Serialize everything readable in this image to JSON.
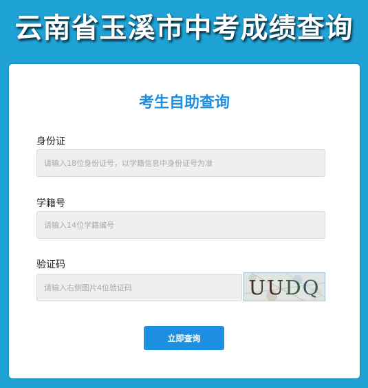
{
  "header": {
    "title": "云南省玉溪市中考成绩查询"
  },
  "form": {
    "title": "考生自助查询",
    "id_card": {
      "label": "身份证",
      "value": "",
      "placeholder": "请输入18位身份证号，以学籍信息中身份证号为准"
    },
    "student_id": {
      "label": "学籍号",
      "value": "",
      "placeholder": "请输入14位学籍编号"
    },
    "captcha": {
      "label": "验证码",
      "value": "",
      "placeholder": "请输入右侧图片4位验证码",
      "image_chars": [
        "U",
        "U",
        "D",
        "Q"
      ]
    },
    "submit_label": "立即查询"
  },
  "colors": {
    "background": "#1fa3d6",
    "accent": "#1d8fe0",
    "card": "#ffffff",
    "input_background": "#efefef"
  }
}
